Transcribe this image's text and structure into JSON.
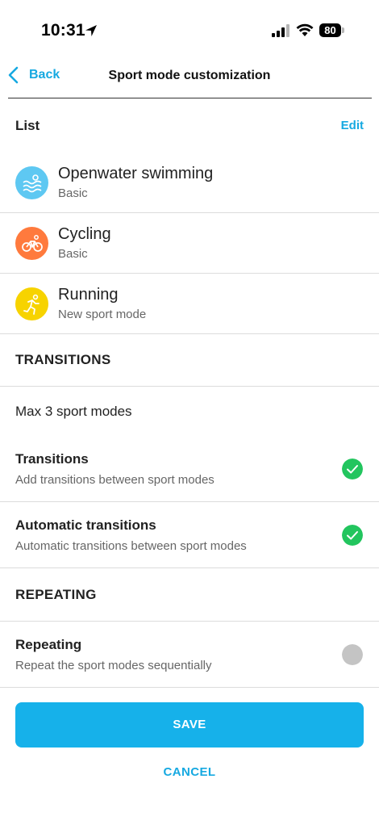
{
  "status_bar": {
    "time": "10:31",
    "battery": "80"
  },
  "nav": {
    "back_label": "Back",
    "title": "Sport mode customization"
  },
  "list": {
    "title": "List",
    "edit_label": "Edit",
    "sports": [
      {
        "name": "Openwater swimming",
        "subtitle": "Basic",
        "icon": "swimming-icon",
        "color": "#5ec8f2"
      },
      {
        "name": "Cycling",
        "subtitle": "Basic",
        "icon": "cycling-icon",
        "color": "#ff7a3d"
      },
      {
        "name": "Running",
        "subtitle": "New sport mode",
        "icon": "running-icon",
        "color": "#f7d300"
      }
    ]
  },
  "transitions": {
    "header": "TRANSITIONS",
    "max_note": "Max 3 sport modes",
    "items": [
      {
        "title": "Transitions",
        "subtitle": "Add transitions between sport modes",
        "checked": true
      },
      {
        "title": "Automatic transitions",
        "subtitle": "Automatic transitions between sport modes",
        "checked": true
      }
    ]
  },
  "repeating": {
    "header": "REPEATING",
    "items": [
      {
        "title": "Repeating",
        "subtitle": "Repeat the sport modes sequentially",
        "checked": false
      }
    ]
  },
  "actions": {
    "save_label": "SAVE",
    "cancel_label": "CANCEL"
  },
  "colors": {
    "accent": "#16a9e1",
    "save_button": "#16b1ea",
    "check_on": "#22c55e",
    "check_off": "#c4c4c4"
  }
}
